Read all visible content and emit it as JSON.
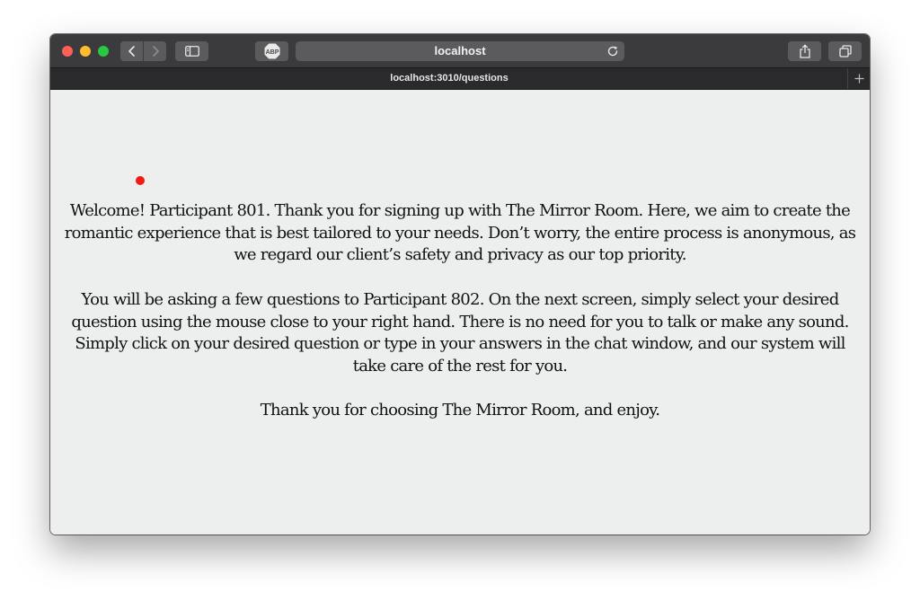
{
  "browser": {
    "address_bar": "localhost",
    "tab_title": "localhost:3010/questions",
    "abp_label": "ABP"
  },
  "content": {
    "paragraphs": [
      "Welcome! Participant 801. Thank you for signing up with The Mirror Room. Here, we aim to create the romantic experience that is best tailored to your needs. Don’t worry, the entire process is anonymous, as we regard our client’s safety and privacy as our top priority.",
      "You will be asking a few questions to Participant 802. On the next screen, simply select your desired question using the mouse close to your right hand. There is no need for you to talk or make any sound. Simply click on your desired question or type in your answers in the chat window, and our system will take care of the rest for you.",
      "Thank you for choosing The Mirror Room, and enjoy."
    ]
  },
  "colors": {
    "toolbar": "#3b3b3d",
    "page_background": "#edeeee",
    "dot": "#f41a14"
  }
}
